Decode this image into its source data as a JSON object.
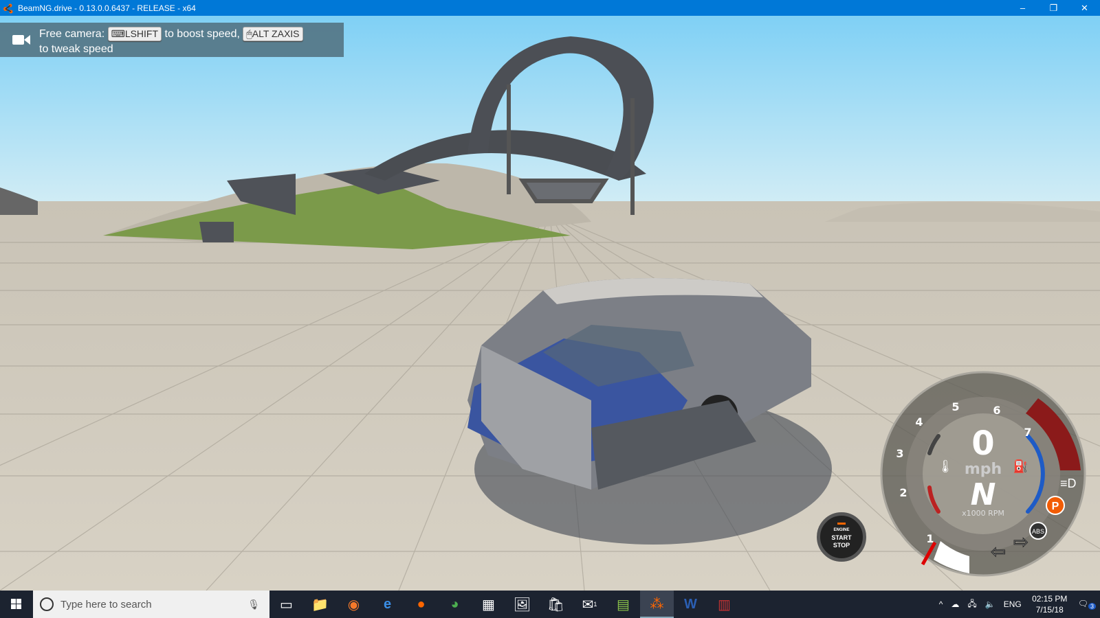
{
  "window": {
    "title": "BeamNG.drive - 0.13.0.0.6437 - RELEASE - x64",
    "minimize": "–",
    "restore": "❐",
    "close": "✕"
  },
  "hint": {
    "prefix": "Free camera:",
    "key1": "LSHIFT",
    "middle": "to boost speed,",
    "key2": "ALT ZAXIS",
    "suffix": "to tweak speed"
  },
  "dashboard": {
    "speed": "0",
    "speed_unit": "mph",
    "gear": "N",
    "rpm_label": "x1000 RPM",
    "rpm_ticks": [
      "1",
      "2",
      "3",
      "4",
      "5",
      "6",
      "7"
    ],
    "rpm_value": 0,
    "parking_brake": "P",
    "abs": "ABS"
  },
  "engine_button": {
    "line1": "ENGINE",
    "line2": "START",
    "line3": "STOP"
  },
  "taskbar": {
    "search_placeholder": "Type here to search",
    "apps": [
      "Task View",
      "File Explorer",
      "Blender",
      "Edge",
      "Firefox",
      "Chrome",
      "Calculator",
      "Photos",
      "Store",
      "Mail",
      "Sheets",
      "BeamNG.drive",
      "Word",
      "WinRAR"
    ],
    "mail_badge": "1",
    "language": "ENG",
    "time": "02:15 PM",
    "date": "7/15/18",
    "notifications": "3"
  }
}
